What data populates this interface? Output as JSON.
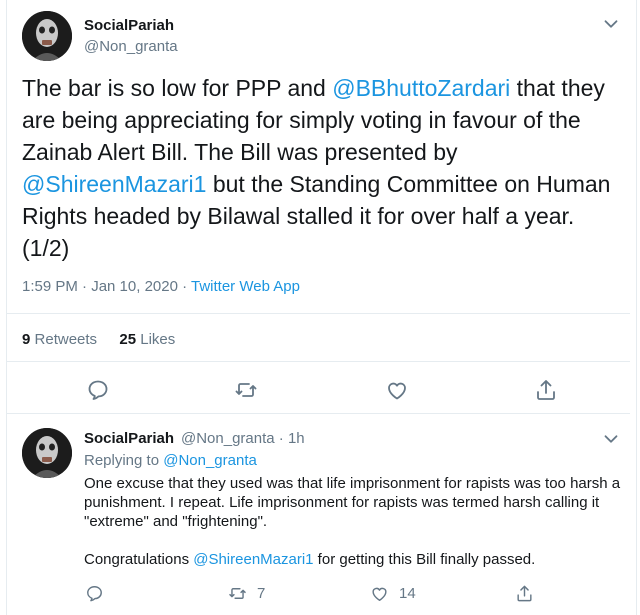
{
  "main_tweet": {
    "author_name": "SocialPariah",
    "author_handle": "@Non_granta",
    "text_parts": [
      "The bar is so low for PPP and ",
      "@BBhuttoZardari",
      " that they are being appreciating for simply voting in favour of the Zainab Alert Bill. The Bill was presented by ",
      "@ShireenMazari1",
      " but the Standing Committee on Human Rights headed by Bilawal stalled it for over half a year. (1/2)"
    ],
    "timestamp": "1:59 PM · Jan 10, 2020 · ",
    "source": "Twitter Web App",
    "retweets_count": "9",
    "retweets_label": "Retweets",
    "likes_count": "25",
    "likes_label": "Likes"
  },
  "reply_tweet": {
    "author_name": "SocialPariah",
    "handle_time": "@Non_granta · 1h",
    "replying_to_label": "Replying to ",
    "replying_to_handle": "@Non_granta",
    "paragraph1": "One excuse that they used was that life imprisonment for rapists was too harsh a punishment. I repeat. Life imprisonment for rapists was termed harsh calling it \"extreme\" and \"frightening\".",
    "paragraph2_before": "Congratulations ",
    "paragraph2_mention": "@ShireenMazari1",
    "paragraph2_after": " for getting this Bill finally passed.",
    "retweet_count": "7",
    "like_count": "14"
  },
  "colors": {
    "link": "#1b95e0",
    "secondary_text": "#657786",
    "divider": "#e6ecf0"
  },
  "icons": [
    "chevron-down-icon",
    "reply-icon",
    "retweet-icon",
    "like-icon",
    "share-icon"
  ]
}
